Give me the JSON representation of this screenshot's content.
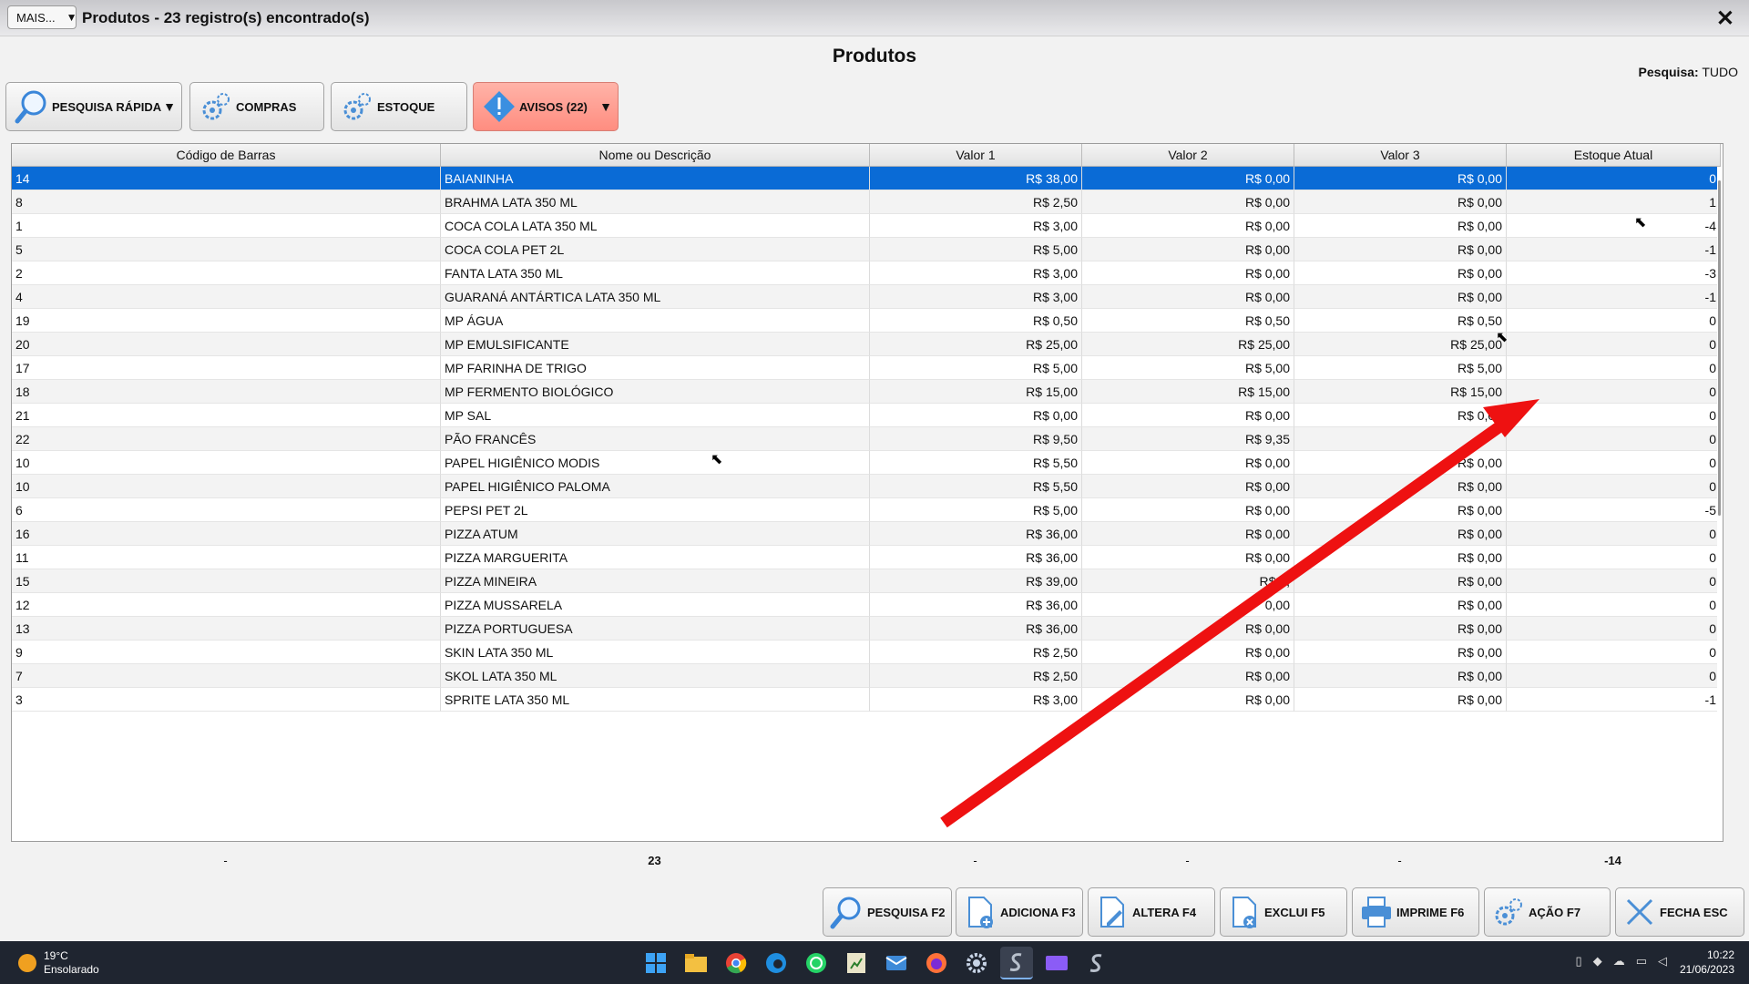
{
  "window": {
    "mais_label": "MAIS...",
    "title": "Produtos - 23 registro(s) encontrado(s)",
    "close": "✕"
  },
  "page": {
    "heading": "Produtos",
    "search_label": "Pesquisa:",
    "search_value": "TUDO"
  },
  "toolbar": {
    "quick_search": "PESQUISA RÁPIDA",
    "compras": "COMPRAS",
    "estoque": "ESTOQUE",
    "avisos": "AVISOS (22)"
  },
  "table": {
    "columns": [
      "Código de Barras",
      "Nome ou Descrição",
      "Valor 1",
      "Valor 2",
      "Valor 3",
      "Estoque Atual"
    ],
    "rows": [
      [
        "14",
        "BAIANINHA",
        "R$ 38,00",
        "R$ 0,00",
        "R$ 0,00",
        "0"
      ],
      [
        "8",
        "BRAHMA LATA 350 ML",
        "R$ 2,50",
        "R$ 0,00",
        "R$ 0,00",
        "1"
      ],
      [
        "1",
        "COCA COLA LATA 350 ML",
        "R$ 3,00",
        "R$ 0,00",
        "R$ 0,00",
        "-4"
      ],
      [
        "5",
        "COCA COLA PET 2L",
        "R$ 5,00",
        "R$ 0,00",
        "R$ 0,00",
        "-1"
      ],
      [
        "2",
        "FANTA LATA 350 ML",
        "R$ 3,00",
        "R$ 0,00",
        "R$ 0,00",
        "-3"
      ],
      [
        "4",
        "GUARANÁ ANTÁRTICA LATA 350 ML",
        "R$ 3,00",
        "R$ 0,00",
        "R$ 0,00",
        "-1"
      ],
      [
        "19",
        "MP ÁGUA",
        "R$ 0,50",
        "R$ 0,50",
        "R$ 0,50",
        "0"
      ],
      [
        "20",
        "MP EMULSIFICANTE",
        "R$ 25,00",
        "R$ 25,00",
        "R$ 25,00",
        "0"
      ],
      [
        "17",
        "MP FARINHA DE TRIGO",
        "R$ 5,00",
        "R$ 5,00",
        "R$ 5,00",
        "0"
      ],
      [
        "18",
        "MP FERMENTO BIOLÓGICO",
        "R$ 15,00",
        "R$ 15,00",
        "R$ 15,00",
        "0"
      ],
      [
        "21",
        "MP SAL",
        "R$ 0,00",
        "R$ 0,00",
        "R$ 0,00",
        "0"
      ],
      [
        "22",
        "PÃO FRANCÊS",
        "R$ 9,50",
        "R$ 9,35",
        "",
        "0"
      ],
      [
        "10",
        "PAPEL HIGIÊNICO MODIS",
        "R$ 5,50",
        "R$ 0,00",
        "R$ 0,00",
        "0"
      ],
      [
        "10",
        "PAPEL HIGIÊNICO PALOMA",
        "R$ 5,50",
        "R$ 0,00",
        "R$ 0,00",
        "0"
      ],
      [
        "6",
        "PEPSI PET 2L",
        "R$ 5,00",
        "R$ 0,00",
        "R$ 0,00",
        "-5"
      ],
      [
        "16",
        "PIZZA ATUM",
        "R$ 36,00",
        "R$ 0,00",
        "R$ 0,00",
        "0"
      ],
      [
        "11",
        "PIZZA MARGUERITA",
        "R$ 36,00",
        "R$ 0,00",
        "R$ 0,00",
        "0"
      ],
      [
        "15",
        "PIZZA MINEIRA",
        "R$ 39,00",
        "R$ 0,",
        "R$ 0,00",
        "0"
      ],
      [
        "12",
        "PIZZA MUSSARELA",
        "R$ 36,00",
        "0,00",
        "R$ 0,00",
        "0"
      ],
      [
        "13",
        "PIZZA PORTUGUESA",
        "R$ 36,00",
        "R$ 0,00",
        "R$ 0,00",
        "0"
      ],
      [
        "9",
        "SKIN LATA 350 ML",
        "R$ 2,50",
        "R$ 0,00",
        "R$ 0,00",
        "0"
      ],
      [
        "7",
        "SKOL LATA 350 ML",
        "R$ 2,50",
        "R$ 0,00",
        "R$ 0,00",
        "0"
      ],
      [
        "3",
        "SPRITE LATA 350 ML",
        "R$ 3,00",
        "R$ 0,00",
        "R$ 0,00",
        "-1"
      ]
    ],
    "selected_row": 0
  },
  "totals": [
    "-",
    "23",
    "-",
    "-",
    "-",
    "-14"
  ],
  "actions": {
    "pesquisa": "PESQUISA F2",
    "adiciona": "ADICIONA F3",
    "altera": "ALTERA F4",
    "exclui": "EXCLUI F5",
    "imprime": "IMPRIME F6",
    "acao": "AÇÃO F7",
    "fecha": "FECHA ESC"
  },
  "taskbar": {
    "temperature": "19°C",
    "condition": "Ensolarado",
    "time": "10:22",
    "date": "21/06/2023"
  },
  "colors": {
    "selection": "#0a6bd6",
    "warning_button": "#ff9a8c",
    "arrow": "#ee1111"
  }
}
